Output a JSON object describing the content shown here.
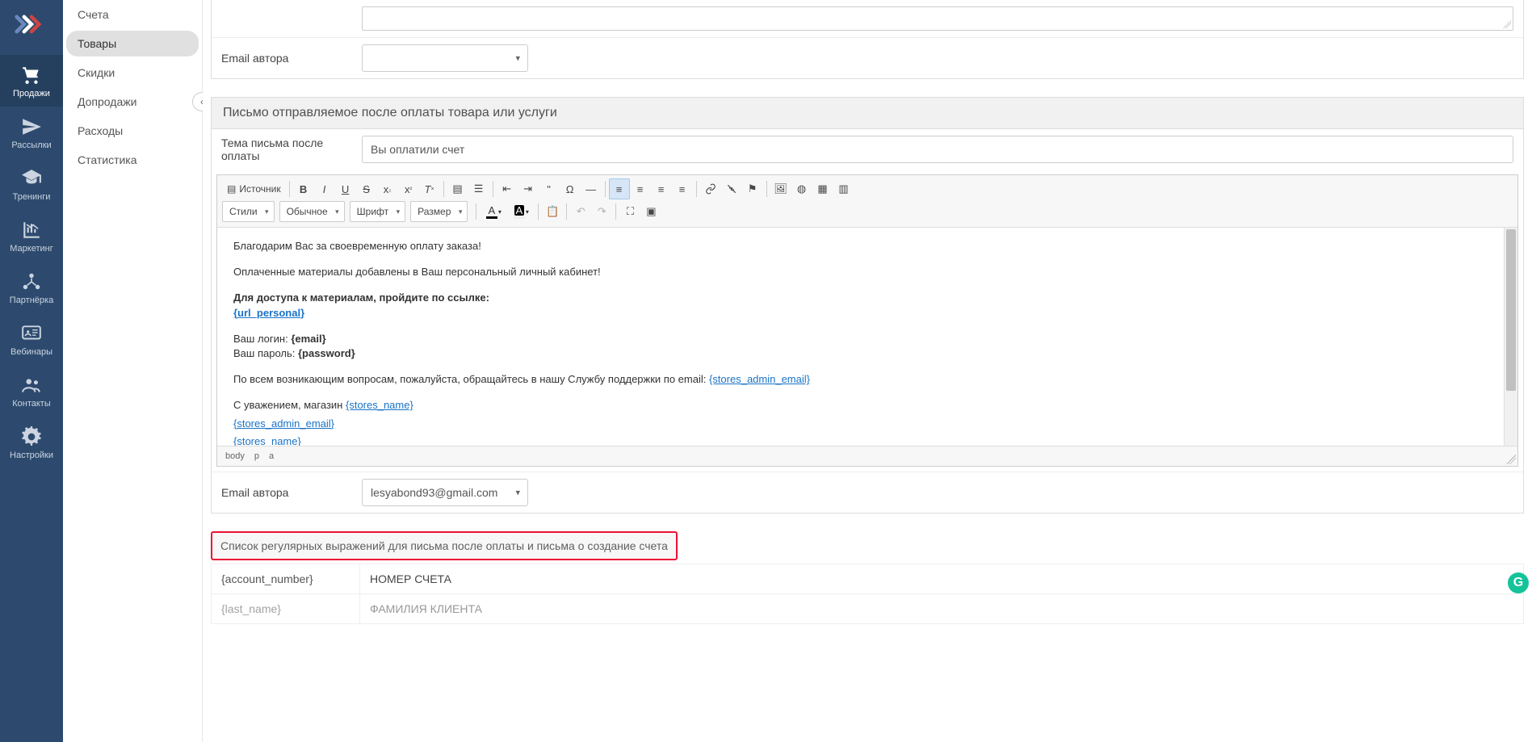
{
  "mainNav": {
    "items": [
      {
        "label": "Продажи",
        "active": true,
        "icon": "cart"
      },
      {
        "label": "Рассылки",
        "active": false,
        "icon": "send"
      },
      {
        "label": "Тренинги",
        "active": false,
        "icon": "graduation"
      },
      {
        "label": "Маркетинг",
        "active": false,
        "icon": "chart"
      },
      {
        "label": "Партнёрка",
        "active": false,
        "icon": "partners"
      },
      {
        "label": "Вебинары",
        "active": false,
        "icon": "webinar"
      },
      {
        "label": "Контакты",
        "active": false,
        "icon": "users"
      },
      {
        "label": "Настройки",
        "active": false,
        "icon": "gear"
      }
    ]
  },
  "subNav": {
    "items": [
      {
        "label": "Счета",
        "active": false
      },
      {
        "label": "Товары",
        "active": true
      },
      {
        "label": "Скидки",
        "active": false
      },
      {
        "label": "Допродажи",
        "active": false
      },
      {
        "label": "Расходы",
        "active": false
      },
      {
        "label": "Статистика",
        "active": false
      }
    ]
  },
  "topForm": {
    "emailAuthorLabel": "Email автора"
  },
  "paymentLetter": {
    "header": "Письмо отправляемое после оплаты товара или услуги",
    "subjectLabel": "Тема письма после оплаты",
    "subjectValue": "Вы оплатили счет",
    "body": {
      "line1": "Благодарим Вас за своевременную оплату заказа!",
      "line2": "Оплаченные материалы добавлены в Ваш персональный личный кабинет!",
      "line3a": "Для доступа к материалам, пройдите по ссылке:",
      "line3b": "{url_personal}",
      "line4a": "Ваш логин: ",
      "line4av": "{email}",
      "line4b": "Ваш пароль: ",
      "line4bv": "{password}",
      "line5a": "По всем возникающим вопросам, пожалуйста, обращайтесь в нашу Службу поддержки по email: ",
      "line5b": "{stores_admin_email}",
      "line6a": "С уважением, магазин ",
      "line6b": "{stores_name}",
      "line7": "{stores_admin_email}",
      "line8": "{stores_name}"
    },
    "breadcrumb": {
      "b": "body",
      "p": "p",
      "a": "a"
    },
    "emailAuthorLabel": "Email автора",
    "emailAuthorValue": "lesyabond93@gmail.com"
  },
  "toolbar": {
    "source": "Источник",
    "styles": "Стили",
    "format": "Обычное",
    "font": "Шрифт",
    "size": "Размер",
    "textColorLetter": "A",
    "bgColorLetter": "A"
  },
  "regex": {
    "header": "Список регулярных выражений для письма после оплаты и письма о создание счета",
    "rows": [
      {
        "key": "{account_number}",
        "val": "НОМЕР СЧЕТА"
      },
      {
        "key": "{last_name}",
        "val": "ФАМИЛИЯ КЛИЕНТА"
      }
    ]
  },
  "grammarly": "G"
}
